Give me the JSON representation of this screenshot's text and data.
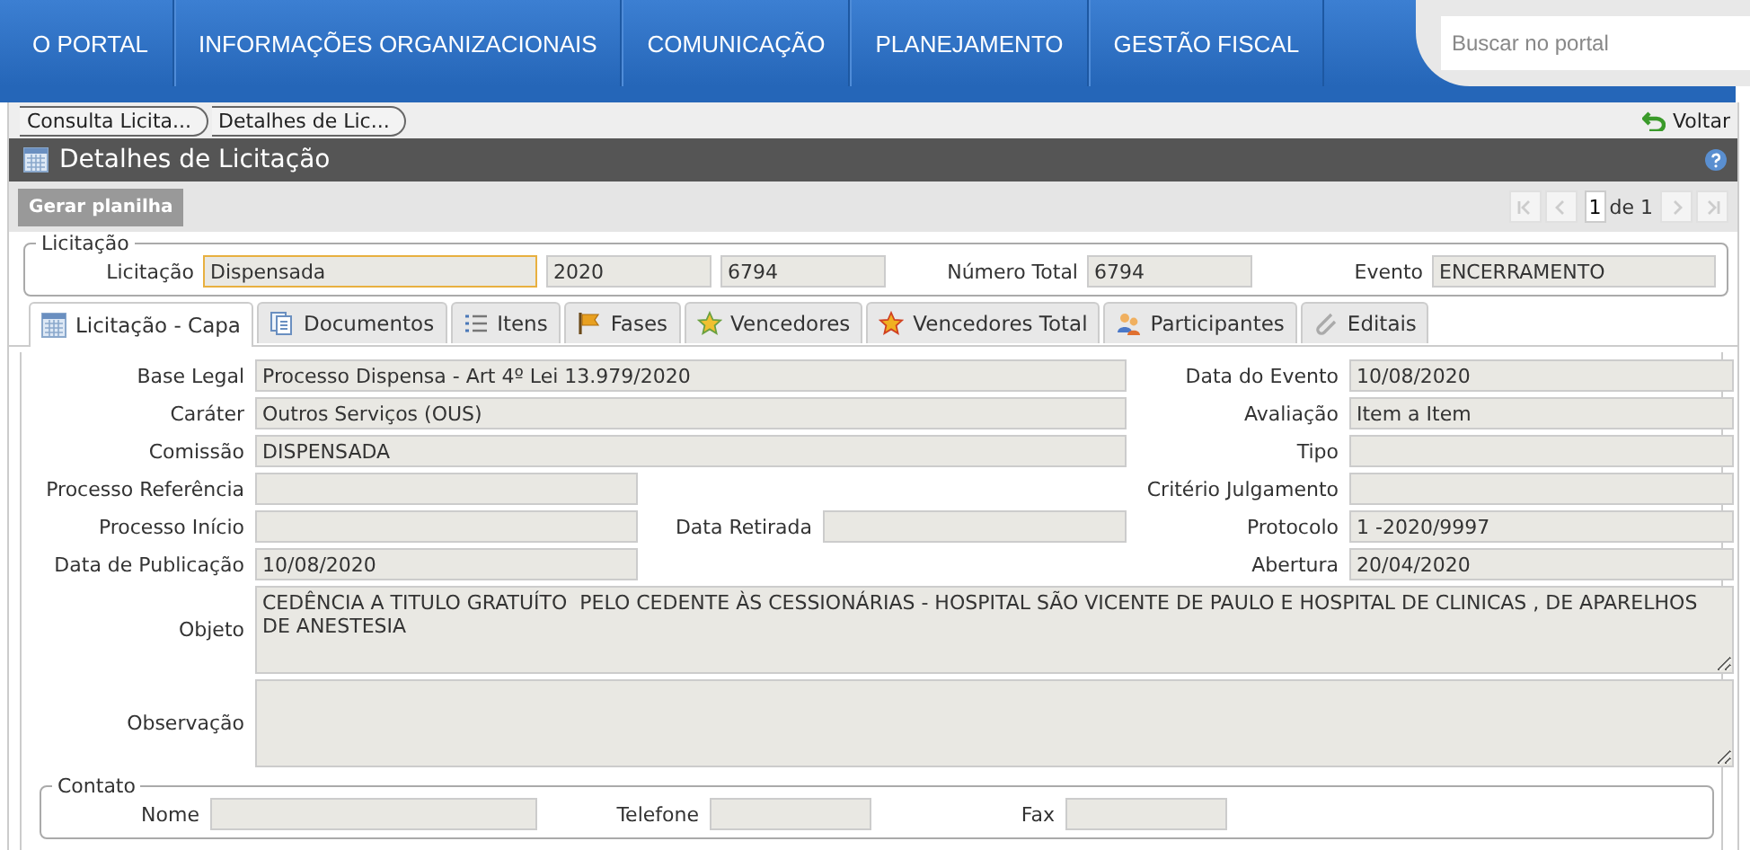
{
  "nav": {
    "items": [
      "O PORTAL",
      "INFORMAÇÕES ORGANIZACIONAIS",
      "COMUNICAÇÃO",
      "PLANEJAMENTO",
      "GESTÃO FISCAL"
    ],
    "search": {
      "placeholder": "Buscar no portal"
    }
  },
  "breadcrumb": [
    "Consulta Licita...",
    "Detalhes de Lic..."
  ],
  "back_link": "Voltar",
  "panel_title": "Detalhes de Licitação",
  "toolbar": {
    "button": "Gerar planilha",
    "page": "1",
    "page_total": "de 1"
  },
  "licitacao": {
    "legend": "Licitação",
    "label": "Licitação",
    "modalidade": "Dispensada",
    "ano": "2020",
    "numero": "6794",
    "numero_total_label": "Número Total",
    "numero_total": "6794",
    "evento_label": "Evento",
    "evento": "ENCERRAMENTO"
  },
  "tabs": [
    {
      "label": "Licitação - Capa",
      "selected": true
    },
    {
      "label": "Documentos",
      "selected": false
    },
    {
      "label": "Itens",
      "selected": false
    },
    {
      "label": "Fases",
      "selected": false
    },
    {
      "label": "Vencedores",
      "selected": false
    },
    {
      "label": "Vencedores Total",
      "selected": false
    },
    {
      "label": "Participantes",
      "selected": false
    },
    {
      "label": "Editais",
      "selected": false
    }
  ],
  "form_rows": [
    {
      "kind": "wide",
      "left": {
        "label": "Base Legal",
        "value": "Processo Dispensa - Art 4º Lei 13.979/2020"
      },
      "right": {
        "label": "Data do Evento",
        "value": "10/08/2020"
      }
    },
    {
      "kind": "wide",
      "left": {
        "label": "Caráter",
        "value": "Outros Serviços (OUS)"
      },
      "right": {
        "label": "Avaliação",
        "value": "Item a Item"
      }
    },
    {
      "kind": "wide",
      "left": {
        "label": "Comissão",
        "value": "DISPENSADA"
      },
      "right": {
        "label": "Tipo"
      }
    },
    {
      "kind": "split",
      "left": {
        "label": "Processo Referência"
      },
      "right": {
        "label": "Critério Julgamento"
      }
    },
    {
      "kind": "split",
      "left": {
        "label": "Processo Início"
      },
      "middle": {
        "label": "Data Retirada"
      },
      "right": {
        "label": "Protocolo",
        "value": "1 -2020/9997"
      }
    },
    {
      "kind": "split",
      "left": {
        "label": "Data de Publicação",
        "value": "10/08/2020"
      },
      "right": {
        "label": "Abertura",
        "value": "20/04/2020"
      }
    }
  ],
  "text_areas": [
    {
      "label": "Objeto",
      "value": "CEDÊNCIA A TITULO GRATUÍTO  PELO CEDENTE ÀS CESSIONÁRIAS - HOSPITAL SÃO VICENTE DE PAULO E HOSPITAL DE CLINICAS , DE APARELHOS DE ANESTESIA"
    },
    {
      "label": "Observação"
    }
  ],
  "contato": {
    "legend": "Contato",
    "fields": [
      {
        "label": "Nome"
      },
      {
        "label": "Telefone"
      },
      {
        "label": "Fax"
      }
    ]
  }
}
